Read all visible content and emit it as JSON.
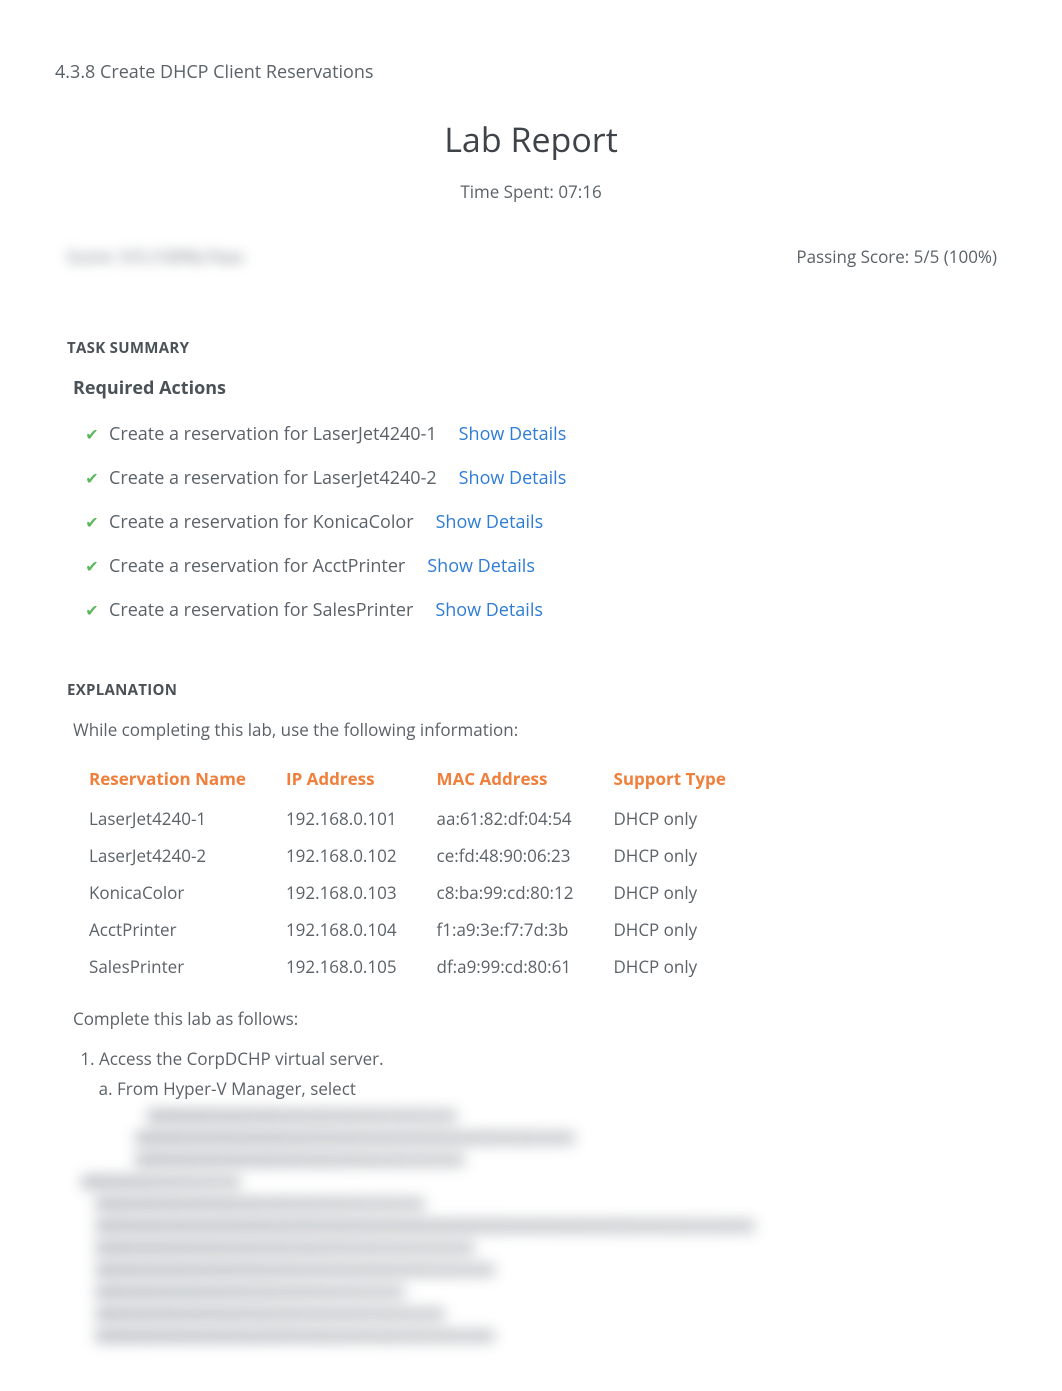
{
  "page": {
    "title": "4.3.8 Create DHCP Client Reservations",
    "heading": "Lab Report",
    "time_spent": "Time Spent: 07:16",
    "score_blur": "Score: 5/5 (100%) Pass",
    "passing_score": "Passing Score: 5/5 (100%)"
  },
  "task_summary": {
    "heading": "TASK SUMMARY",
    "required_actions_label": "Required Actions",
    "show_details_label": "Show Details",
    "actions": [
      {
        "text": "Create a reservation for LaserJet4240-1"
      },
      {
        "text": "Create a reservation for LaserJet4240-2"
      },
      {
        "text": "Create a reservation for KonicaColor"
      },
      {
        "text": "Create a reservation for AcctPrinter"
      },
      {
        "text": "Create a reservation for SalesPrinter"
      }
    ]
  },
  "explanation": {
    "heading": "EXPLANATION",
    "intro": "While completing this lab, use the following information:",
    "table": {
      "headers": {
        "name": "Reservation Name",
        "ip": "IP Address",
        "mac": "MAC Address",
        "support": "Support Type"
      },
      "rows": [
        {
          "name": "LaserJet4240-1",
          "ip": "192.168.0.101",
          "mac": "aa:61:82:df:04:54",
          "support": "DHCP only"
        },
        {
          "name": "LaserJet4240-2",
          "ip": "192.168.0.102",
          "mac": "ce:fd:48:90:06:23",
          "support": "DHCP only"
        },
        {
          "name": "KonicaColor",
          "ip": "192.168.0.103",
          "mac": "c8:ba:99:cd:80:12",
          "support": "DHCP only"
        },
        {
          "name": "AcctPrinter",
          "ip": "192.168.0.104",
          "mac": "f1:a9:3e:f7:7d:3b",
          "support": "DHCP only"
        },
        {
          "name": "SalesPrinter",
          "ip": "192.168.0.105",
          "mac": "df:a9:99:cd:80:61",
          "support": "DHCP only"
        }
      ]
    },
    "complete_text": "Complete this lab as follows:",
    "step1": "Access the CorpDCHP virtual server.",
    "step1a": "From Hyper-V Manager, select"
  }
}
